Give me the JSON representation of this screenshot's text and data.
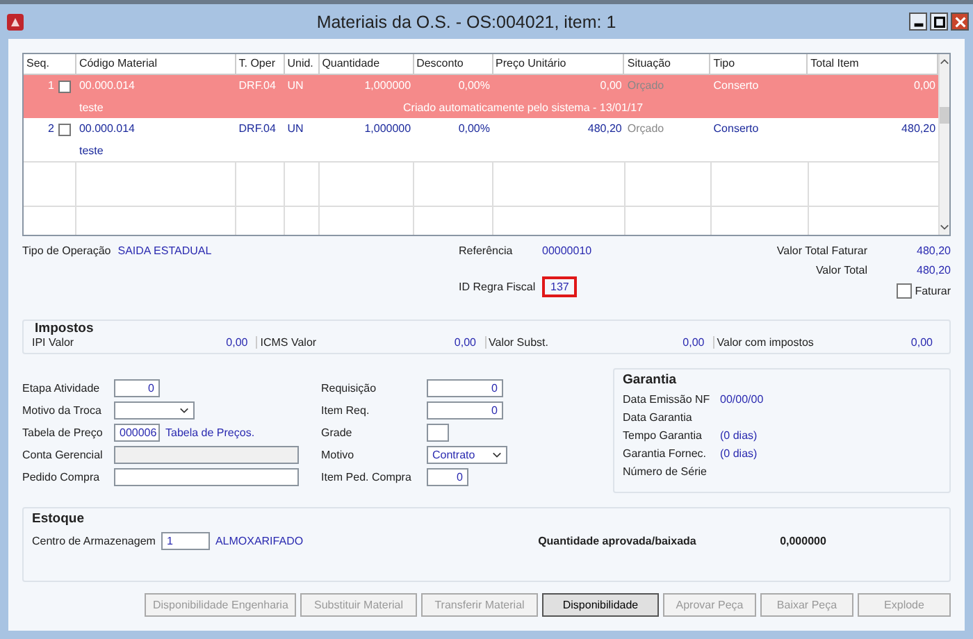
{
  "window": {
    "title": "Materiais da O.S. - OS:004021, item: 1"
  },
  "table": {
    "columns": [
      "Seq.",
      "Código Material",
      "T. Oper",
      "Unid.",
      "Quantidade",
      "Desconto",
      "Preço Unitário",
      "Situação",
      "Tipo",
      "Total Item"
    ],
    "rows": [
      {
        "seq": "1",
        "checked": false,
        "highlighted": true,
        "code": "00.000.014",
        "oper": "DRF.04",
        "unit": "UN",
        "qty": "1,000000",
        "discount": "0,00%",
        "price": "0,00",
        "status": "Orçado",
        "type": "Conserto",
        "total": "0,00",
        "note": "teste",
        "message": "Criado automaticamente pelo sistema - 13/01/17"
      },
      {
        "seq": "2",
        "checked": false,
        "highlighted": false,
        "code": "00.000.014",
        "oper": "DRF.04",
        "unit": "UN",
        "qty": "1,000000",
        "discount": "0,00%",
        "price": "480,20",
        "status": "Orçado",
        "type": "Conserto",
        "total": "480,20",
        "note": "teste"
      }
    ]
  },
  "info": {
    "operation_label": "Tipo de Operação",
    "operation": "SAIDA ESTADUAL",
    "reference_label": "Referência",
    "reference": "00000010",
    "rule_label": "ID Regra Fiscal",
    "rule": "137",
    "total_bill_label": "Valor Total Faturar",
    "total_bill": "480,20",
    "total_label": "Valor Total",
    "total": "480,20",
    "bill_label": "Faturar",
    "bill_checked": false
  },
  "taxes": {
    "title": "Impostos",
    "items": [
      {
        "label": "IPI Valor",
        "value": "0,00"
      },
      {
        "label": "ICMS Valor",
        "value": "0,00"
      },
      {
        "label": "Valor Subst.",
        "value": "0,00"
      },
      {
        "label": "Valor com impostos",
        "value": "0,00"
      }
    ]
  },
  "form_left": [
    {
      "label": "Etapa Atividade",
      "kind": "number",
      "value": "0"
    },
    {
      "label": "Motivo da Troca",
      "kind": "select"
    },
    {
      "label": "Tabela de Preço",
      "kind": "lookup",
      "value": "000006",
      "extra": "Tabela de Preços."
    },
    {
      "label": "Conta Gerencial",
      "kind": "disabled"
    },
    {
      "label": "Pedido Compra",
      "kind": "wide"
    }
  ],
  "form_mid": [
    {
      "label": "Requisição",
      "kind": "number",
      "value": "0"
    },
    {
      "label": "Item Req.",
      "kind": "number",
      "value": "0"
    },
    {
      "label": "Grade",
      "kind": "tiny"
    },
    {
      "label": "Motivo",
      "kind": "select",
      "value": "Contrato"
    },
    {
      "label": "Item Ped. Compra",
      "kind": "short",
      "value": "0"
    }
  ],
  "warranty": {
    "title": "Garantia",
    "items": [
      {
        "label": "Data Emissão NF",
        "value": "00/00/00"
      },
      {
        "label": "Data Garantia"
      },
      {
        "label": "Tempo Garantia",
        "value": "(0 dias)"
      },
      {
        "label": "Garantia Fornec.",
        "value": "(0 dias)"
      },
      {
        "label": "Número de Série"
      }
    ]
  },
  "stock": {
    "title": "Estoque",
    "center_label": "Centro de Armazenagem",
    "center": "1",
    "center_name": "ALMOXARIFADO",
    "qty_label": "Quantidade aprovada/baixada",
    "qty": "0,000000"
  },
  "buttons": [
    {
      "label": "Disponibilidade Engenharia",
      "disabled": true
    },
    {
      "label": "Substituir Material",
      "disabled": true
    },
    {
      "label": "Transferir Material",
      "disabled": true
    },
    {
      "label": "Disponibilidade",
      "disabled": false
    },
    {
      "label": "Aprovar Peça",
      "disabled": true
    },
    {
      "label": "Baixar Peça",
      "disabled": true
    },
    {
      "label": "Explode",
      "disabled": true
    }
  ]
}
